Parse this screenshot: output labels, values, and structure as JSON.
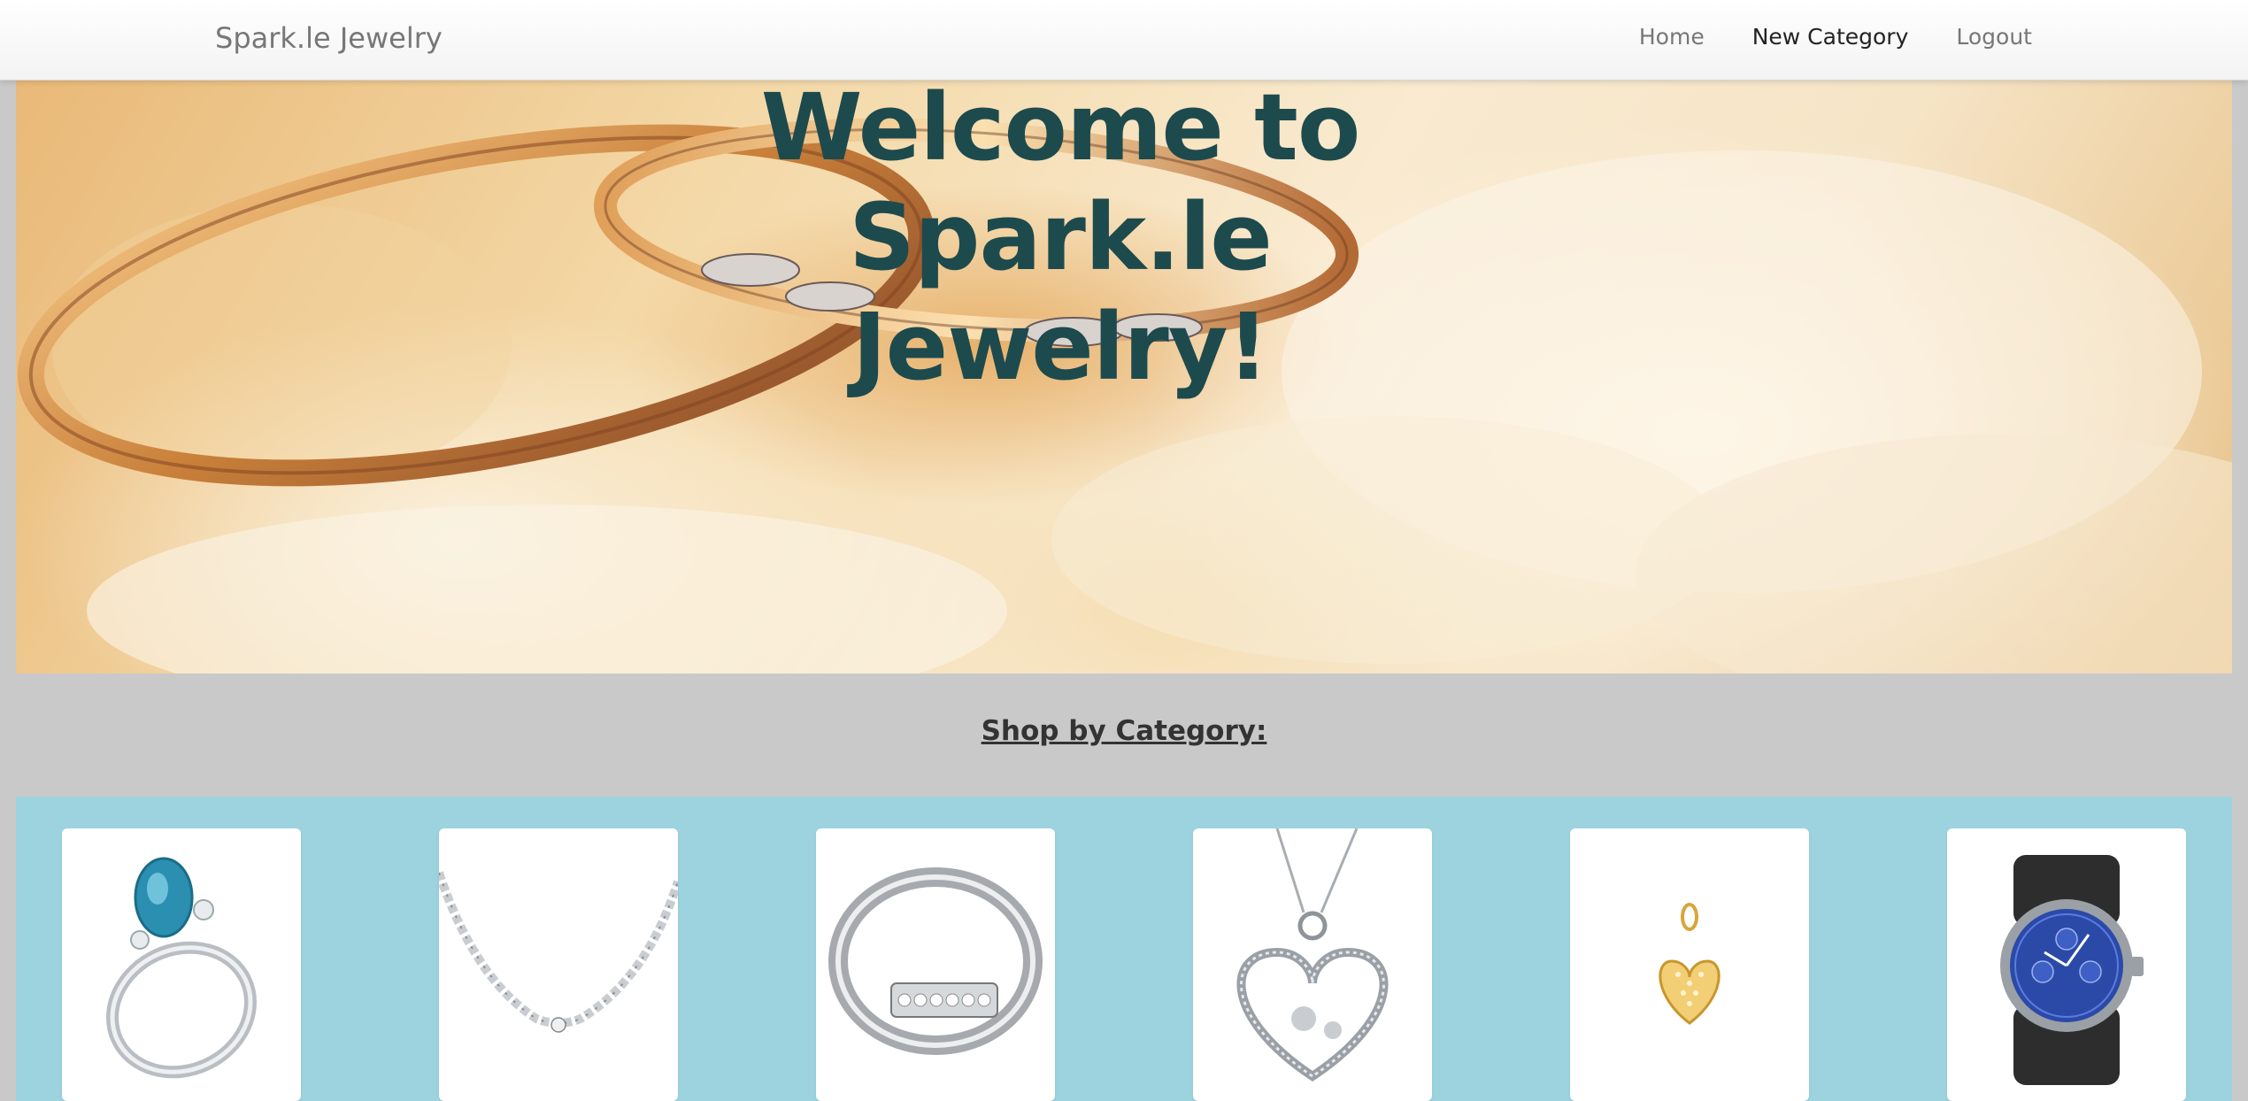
{
  "navbar": {
    "brand": "Spark.le Jewelry",
    "links": [
      {
        "label": "Home",
        "active": false
      },
      {
        "label": "New Category",
        "active": true
      },
      {
        "label": "Logout",
        "active": false
      }
    ]
  },
  "hero": {
    "title_line1": "Welcome to Spark.le",
    "title_line2": "Jewelry!"
  },
  "shop": {
    "heading": "Shop by Category:"
  },
  "categories": [
    {
      "icon": "blue-gem-ring-icon"
    },
    {
      "icon": "diamond-necklace-icon"
    },
    {
      "icon": "silver-bypass-ring-icon"
    },
    {
      "icon": "heart-pendant-necklace-icon"
    },
    {
      "icon": "gold-heart-charm-icon"
    },
    {
      "icon": "smart-watch-icon"
    }
  ],
  "colors": {
    "background": "#c9c9c9",
    "hero_title": "#1d4a4d",
    "category_band": "#9dd3df",
    "nav_text": "#777777",
    "nav_active": "#222222"
  }
}
